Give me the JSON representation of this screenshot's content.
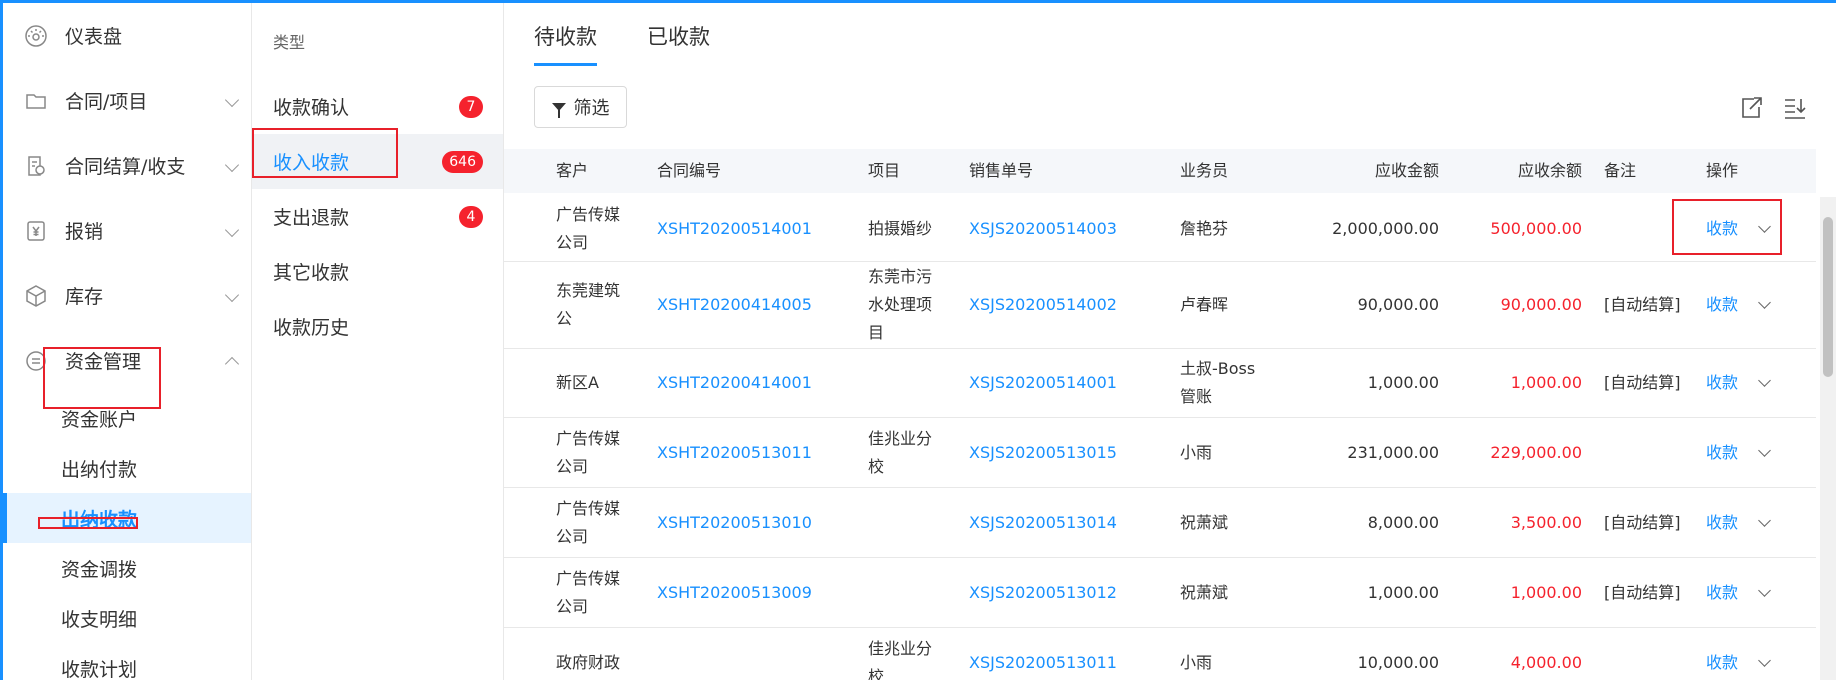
{
  "sidebar": {
    "items": [
      {
        "label": "仪表盘",
        "icon": "dashboard-icon",
        "expandable": false
      },
      {
        "label": "合同/项目",
        "icon": "folder-icon",
        "expandable": true
      },
      {
        "label": "合同结算/收支",
        "icon": "document-settle-icon",
        "expandable": true
      },
      {
        "label": "报销",
        "icon": "yen-icon",
        "expandable": true
      },
      {
        "label": "库存",
        "icon": "box-icon",
        "expandable": true
      },
      {
        "label": "资金管理",
        "icon": "money-icon",
        "expandable": true,
        "expanded": true
      }
    ],
    "sub_items": [
      "资金账户",
      "出纳付款",
      "出纳收款",
      "资金调拨",
      "收支明细",
      "收款计划"
    ],
    "active_sub": "出纳收款"
  },
  "type_panel": {
    "header": "类型",
    "items": [
      {
        "label": "收款确认",
        "badge": "7"
      },
      {
        "label": "收入收款",
        "badge": "646"
      },
      {
        "label": "支出退款",
        "badge": "4"
      },
      {
        "label": "其它收款",
        "badge": ""
      },
      {
        "label": "收款历史",
        "badge": ""
      }
    ],
    "active": "收入收款"
  },
  "main": {
    "tabs": [
      "待收款",
      "已收款"
    ],
    "active_tab": "待收款",
    "filter_label": "筛选",
    "columns": [
      "客户",
      "合同编号",
      "项目",
      "销售单号",
      "业务员",
      "应收金额",
      "应收余额",
      "备注",
      "操作"
    ],
    "rows": [
      {
        "customer": "广告传媒公司",
        "contract": "XSHT20200514001",
        "project": "拍摄婚纱",
        "sale": "XSJS20200514003",
        "staff": "詹艳芬",
        "amount": "2,000,000.00",
        "balance": "500,000.00",
        "note": "",
        "op": "收款"
      },
      {
        "customer": "东莞建筑公",
        "contract": "XSHT20200414005",
        "project": "东莞市污水处理项目",
        "sale": "XSJS20200514002",
        "staff": "卢春晖",
        "amount": "90,000.00",
        "balance": "90,000.00",
        "note": "[自动结算]",
        "op": "收款"
      },
      {
        "customer": "新区A",
        "contract": "XSHT20200414001",
        "project": "",
        "sale": "XSJS20200514001",
        "staff": "土叔-Boss管账",
        "amount": "1,000.00",
        "balance": "1,000.00",
        "note": "[自动结算]",
        "op": "收款"
      },
      {
        "customer": "广告传媒公司",
        "contract": "XSHT20200513011",
        "project": "佳兆业分校",
        "sale": "XSJS20200513015",
        "staff": "小雨",
        "amount": "231,000.00",
        "balance": "229,000.00",
        "note": "",
        "op": "收款"
      },
      {
        "customer": "广告传媒公司",
        "contract": "XSHT20200513010",
        "project": "",
        "sale": "XSJS20200513014",
        "staff": "祝萧斌",
        "amount": "8,000.00",
        "balance": "3,500.00",
        "note": "[自动结算]",
        "op": "收款"
      },
      {
        "customer": "广告传媒公司",
        "contract": "XSHT20200513009",
        "project": "",
        "sale": "XSJS20200513012",
        "staff": "祝萧斌",
        "amount": "1,000.00",
        "balance": "1,000.00",
        "note": "[自动结算]",
        "op": "收款"
      },
      {
        "customer": "政府财政",
        "contract": "",
        "project": "佳兆业分校",
        "sale": "XSJS20200513011",
        "staff": "小雨",
        "amount": "10,000.00",
        "balance": "4,000.00",
        "note": "",
        "op": "收款"
      }
    ]
  },
  "colors": {
    "accent": "#1890ff",
    "danger": "#f5222d",
    "highlight": "#e8202a"
  }
}
